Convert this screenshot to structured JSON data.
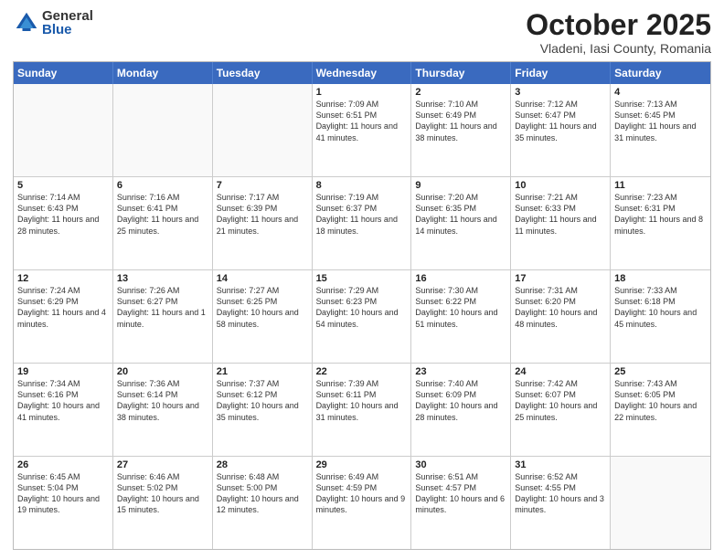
{
  "header": {
    "logo_general": "General",
    "logo_blue": "Blue",
    "month_title": "October 2025",
    "location": "Vladeni, Iasi County, Romania"
  },
  "days_of_week": [
    "Sunday",
    "Monday",
    "Tuesday",
    "Wednesday",
    "Thursday",
    "Friday",
    "Saturday"
  ],
  "weeks": [
    [
      {
        "day": "",
        "info": "",
        "empty": true
      },
      {
        "day": "",
        "info": "",
        "empty": true
      },
      {
        "day": "",
        "info": "",
        "empty": true
      },
      {
        "day": "1",
        "info": "Sunrise: 7:09 AM\nSunset: 6:51 PM\nDaylight: 11 hours and 41 minutes.",
        "empty": false
      },
      {
        "day": "2",
        "info": "Sunrise: 7:10 AM\nSunset: 6:49 PM\nDaylight: 11 hours and 38 minutes.",
        "empty": false
      },
      {
        "day": "3",
        "info": "Sunrise: 7:12 AM\nSunset: 6:47 PM\nDaylight: 11 hours and 35 minutes.",
        "empty": false
      },
      {
        "day": "4",
        "info": "Sunrise: 7:13 AM\nSunset: 6:45 PM\nDaylight: 11 hours and 31 minutes.",
        "empty": false
      }
    ],
    [
      {
        "day": "5",
        "info": "Sunrise: 7:14 AM\nSunset: 6:43 PM\nDaylight: 11 hours and 28 minutes.",
        "empty": false
      },
      {
        "day": "6",
        "info": "Sunrise: 7:16 AM\nSunset: 6:41 PM\nDaylight: 11 hours and 25 minutes.",
        "empty": false
      },
      {
        "day": "7",
        "info": "Sunrise: 7:17 AM\nSunset: 6:39 PM\nDaylight: 11 hours and 21 minutes.",
        "empty": false
      },
      {
        "day": "8",
        "info": "Sunrise: 7:19 AM\nSunset: 6:37 PM\nDaylight: 11 hours and 18 minutes.",
        "empty": false
      },
      {
        "day": "9",
        "info": "Sunrise: 7:20 AM\nSunset: 6:35 PM\nDaylight: 11 hours and 14 minutes.",
        "empty": false
      },
      {
        "day": "10",
        "info": "Sunrise: 7:21 AM\nSunset: 6:33 PM\nDaylight: 11 hours and 11 minutes.",
        "empty": false
      },
      {
        "day": "11",
        "info": "Sunrise: 7:23 AM\nSunset: 6:31 PM\nDaylight: 11 hours and 8 minutes.",
        "empty": false
      }
    ],
    [
      {
        "day": "12",
        "info": "Sunrise: 7:24 AM\nSunset: 6:29 PM\nDaylight: 11 hours and 4 minutes.",
        "empty": false
      },
      {
        "day": "13",
        "info": "Sunrise: 7:26 AM\nSunset: 6:27 PM\nDaylight: 11 hours and 1 minute.",
        "empty": false
      },
      {
        "day": "14",
        "info": "Sunrise: 7:27 AM\nSunset: 6:25 PM\nDaylight: 10 hours and 58 minutes.",
        "empty": false
      },
      {
        "day": "15",
        "info": "Sunrise: 7:29 AM\nSunset: 6:23 PM\nDaylight: 10 hours and 54 minutes.",
        "empty": false
      },
      {
        "day": "16",
        "info": "Sunrise: 7:30 AM\nSunset: 6:22 PM\nDaylight: 10 hours and 51 minutes.",
        "empty": false
      },
      {
        "day": "17",
        "info": "Sunrise: 7:31 AM\nSunset: 6:20 PM\nDaylight: 10 hours and 48 minutes.",
        "empty": false
      },
      {
        "day": "18",
        "info": "Sunrise: 7:33 AM\nSunset: 6:18 PM\nDaylight: 10 hours and 45 minutes.",
        "empty": false
      }
    ],
    [
      {
        "day": "19",
        "info": "Sunrise: 7:34 AM\nSunset: 6:16 PM\nDaylight: 10 hours and 41 minutes.",
        "empty": false
      },
      {
        "day": "20",
        "info": "Sunrise: 7:36 AM\nSunset: 6:14 PM\nDaylight: 10 hours and 38 minutes.",
        "empty": false
      },
      {
        "day": "21",
        "info": "Sunrise: 7:37 AM\nSunset: 6:12 PM\nDaylight: 10 hours and 35 minutes.",
        "empty": false
      },
      {
        "day": "22",
        "info": "Sunrise: 7:39 AM\nSunset: 6:11 PM\nDaylight: 10 hours and 31 minutes.",
        "empty": false
      },
      {
        "day": "23",
        "info": "Sunrise: 7:40 AM\nSunset: 6:09 PM\nDaylight: 10 hours and 28 minutes.",
        "empty": false
      },
      {
        "day": "24",
        "info": "Sunrise: 7:42 AM\nSunset: 6:07 PM\nDaylight: 10 hours and 25 minutes.",
        "empty": false
      },
      {
        "day": "25",
        "info": "Sunrise: 7:43 AM\nSunset: 6:05 PM\nDaylight: 10 hours and 22 minutes.",
        "empty": false
      }
    ],
    [
      {
        "day": "26",
        "info": "Sunrise: 6:45 AM\nSunset: 5:04 PM\nDaylight: 10 hours and 19 minutes.",
        "empty": false
      },
      {
        "day": "27",
        "info": "Sunrise: 6:46 AM\nSunset: 5:02 PM\nDaylight: 10 hours and 15 minutes.",
        "empty": false
      },
      {
        "day": "28",
        "info": "Sunrise: 6:48 AM\nSunset: 5:00 PM\nDaylight: 10 hours and 12 minutes.",
        "empty": false
      },
      {
        "day": "29",
        "info": "Sunrise: 6:49 AM\nSunset: 4:59 PM\nDaylight: 10 hours and 9 minutes.",
        "empty": false
      },
      {
        "day": "30",
        "info": "Sunrise: 6:51 AM\nSunset: 4:57 PM\nDaylight: 10 hours and 6 minutes.",
        "empty": false
      },
      {
        "day": "31",
        "info": "Sunrise: 6:52 AM\nSunset: 4:55 PM\nDaylight: 10 hours and 3 minutes.",
        "empty": false
      },
      {
        "day": "",
        "info": "",
        "empty": true
      }
    ]
  ]
}
